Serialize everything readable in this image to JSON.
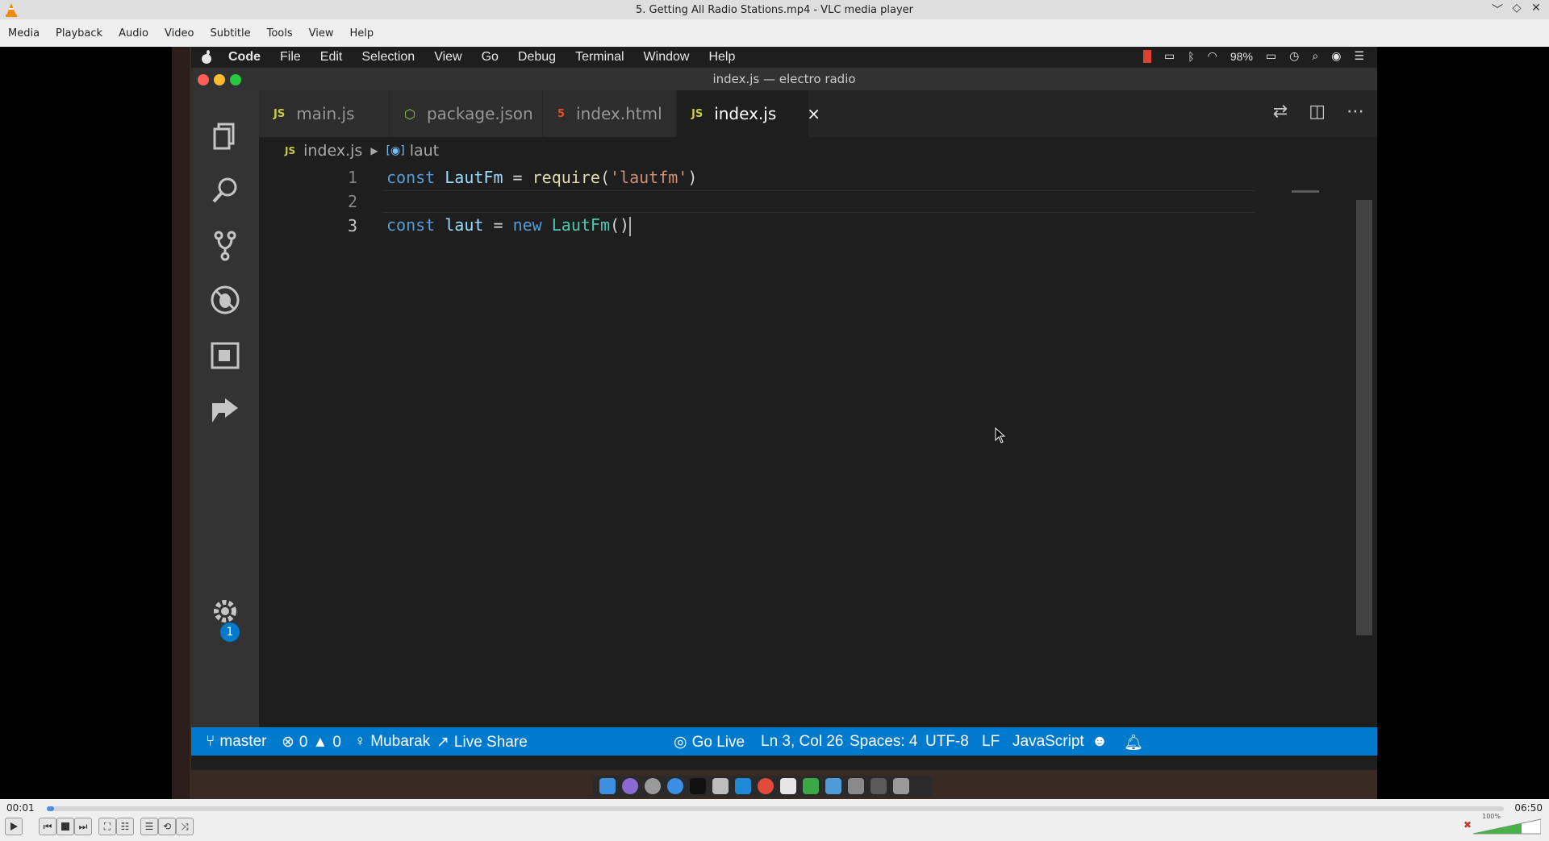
{
  "vlc": {
    "title": "5. Getting All Radio Stations.mp4 - VLC media player",
    "menu": [
      "Media",
      "Playback",
      "Audio",
      "Video",
      "Subtitle",
      "Tools",
      "View",
      "Help"
    ],
    "time_elapsed": "00:01",
    "time_total": "06:50",
    "progress_fraction": 0.005,
    "volume_percent": "100%"
  },
  "mac_menubar": {
    "app": "Code",
    "items": [
      "File",
      "Edit",
      "Selection",
      "View",
      "Go",
      "Debug",
      "Terminal",
      "Window",
      "Help"
    ],
    "battery": "98%"
  },
  "vscode": {
    "window_title": "index.js — electro radio",
    "tabs": [
      {
        "label": "main.js",
        "icon": "JS"
      },
      {
        "label": "package.json",
        "icon": "⬡"
      },
      {
        "label": "index.html",
        "icon": "5"
      },
      {
        "label": "index.js",
        "icon": "JS",
        "close": "×"
      }
    ],
    "breadcrumb": {
      "file": "index.js",
      "symbol": "laut"
    },
    "lines": [
      {
        "n": "1"
      },
      {
        "n": "2"
      },
      {
        "n": "3"
      }
    ],
    "code": {
      "l1_kw": "const",
      "l1_var": "LautFm",
      "l1_eq": " = ",
      "l1_fn": "require",
      "l1_p1": "(",
      "l1_str": "'lautfm'",
      "l1_p2": ")",
      "l3_kw": "const",
      "l3_var": "laut",
      "l3_eq": " = ",
      "l3_new": "new",
      "l3_cls": "LautFm",
      "l3_p": "()"
    },
    "manage_badge": "1",
    "status": {
      "branch": "master",
      "errors": "0",
      "warnings": "0",
      "user": "Mubarak",
      "live_share": "Live Share",
      "go_live": "Go Live",
      "position": "Ln 3, Col 26",
      "spaces": "Spaces: 4",
      "encoding": "UTF-8",
      "eol": "LF",
      "language": "JavaScript"
    }
  },
  "colors": {
    "statusbar": "#007acc",
    "editor_bg": "#1e1e1e",
    "vlc_progress": "#4a8ee0"
  }
}
